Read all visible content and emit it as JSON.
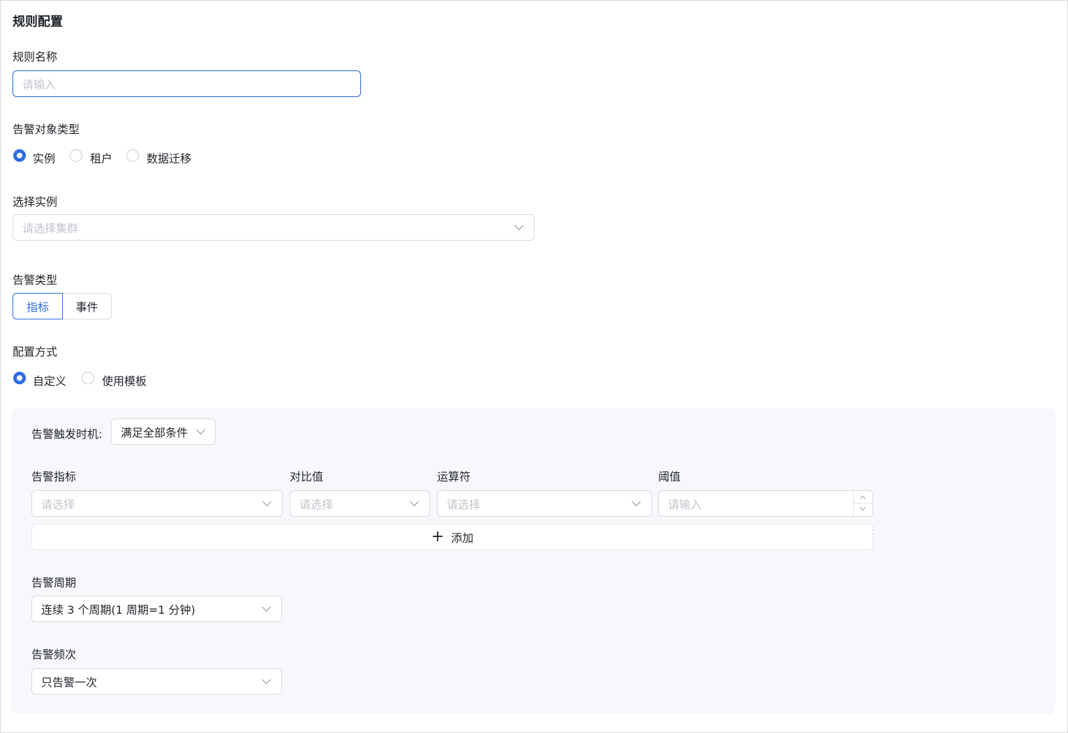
{
  "section_title": "规则配置",
  "rule_name": {
    "label": "规则名称",
    "placeholder": "请输入"
  },
  "target_type": {
    "label": "告警对象类型",
    "options": [
      "实例",
      "租户",
      "数据迁移"
    ],
    "selected": "实例"
  },
  "select_instance": {
    "label": "选择实例",
    "placeholder": "请选择集群"
  },
  "alert_type": {
    "label": "告警类型",
    "options": [
      "指标",
      "事件"
    ],
    "selected": "指标"
  },
  "config_mode": {
    "label": "配置方式",
    "options": [
      "自定义",
      "使用模板"
    ],
    "selected": "自定义"
  },
  "trigger": {
    "label": "告警触发时机:",
    "value": "满足全部条件"
  },
  "conditions": {
    "headers": [
      "告警指标",
      "对比值",
      "运算符",
      "阈值"
    ],
    "metric_placeholder": "请选择",
    "compare_placeholder": "请选择",
    "operator_placeholder": "请选择",
    "threshold_placeholder": "请输入",
    "add_label": "添加"
  },
  "period": {
    "label": "告警周期",
    "value": "连续 3 个周期(1 周期=1 分钟)"
  },
  "frequency": {
    "label": "告警频次",
    "value": "只告警一次"
  },
  "colors": {
    "accent": "#2e6be6",
    "panel_bg": "#f7f8fb",
    "border": "#d9dbe0",
    "placeholder": "#c0c4cc"
  }
}
